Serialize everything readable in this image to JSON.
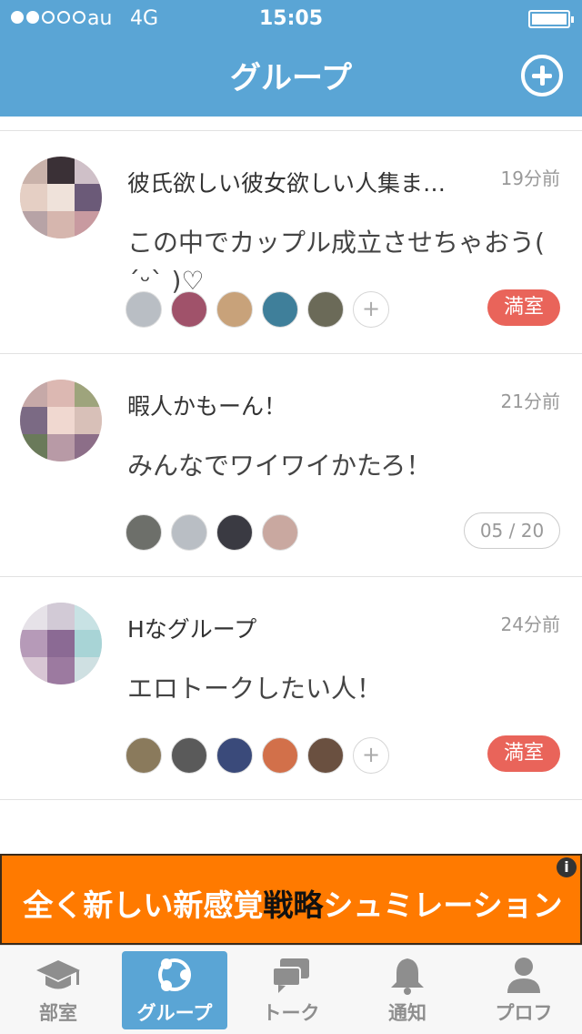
{
  "status_bar": {
    "signal_dots_on": 2,
    "signal_dots_total": 5,
    "carrier": "au",
    "network": "4G",
    "time": "15:05",
    "battery_level": 1.0
  },
  "nav": {
    "title": "グループ",
    "add_icon": "plus-circle-icon"
  },
  "groups": [
    {
      "title": "彼氏欲しい彼女欲しい人集ま…",
      "time": "19分前",
      "description": "この中でカップル成立させちゃおう( ´ᵕ` )♡",
      "member_count": 5,
      "show_more": true,
      "more_label": "+",
      "status": "満室",
      "status_type": "full",
      "avatar_colors": [
        "#d9c2b8",
        "#c89aa0",
        "#efe2da",
        "#6b5a78"
      ]
    },
    {
      "title": "暇人かもーん！",
      "time": "21分前",
      "description": "みんなでワイワイかたろ！",
      "member_count": 4,
      "show_more": false,
      "more_label": "",
      "status": "05 / 20",
      "status_type": "count",
      "avatar_colors": [
        "#c6a9a8",
        "#e8ccc6",
        "#9ea47c",
        "#7b6a84"
      ]
    },
    {
      "title": "Hなグループ",
      "time": "24分前",
      "description": "エロトークしたい人！",
      "member_count": 5,
      "show_more": true,
      "more_label": "+",
      "status": "満室",
      "status_type": "full",
      "avatar_colors": [
        "#d7d4dc",
        "#8b6a94",
        "#c8e2e4",
        "#b69ab8"
      ]
    }
  ],
  "banner": {
    "text_before": "全く新しい新感覚",
    "text_emph": "戦略",
    "text_after": "シュミレーション",
    "info_label": "i",
    "bg_color": "#ff7a00"
  },
  "tabbar": {
    "items": [
      {
        "label": "部室",
        "icon": "graduation-cap-icon",
        "active": false
      },
      {
        "label": "グループ",
        "icon": "group-share-icon",
        "active": true
      },
      {
        "label": "トーク",
        "icon": "chat-bubbles-icon",
        "active": false
      },
      {
        "label": "通知",
        "icon": "bell-icon",
        "active": false
      },
      {
        "label": "プロフ",
        "icon": "person-icon",
        "active": false
      }
    ]
  },
  "colors": {
    "brand": "#5aa5d5",
    "full_badge": "#e9645a",
    "banner": "#ff7a00"
  }
}
